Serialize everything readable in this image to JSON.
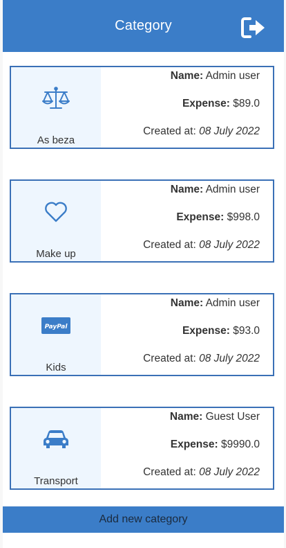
{
  "header": {
    "title": "Category",
    "logout_icon": "sign-out-icon"
  },
  "labels": {
    "name": "Name:",
    "expense": "Expense:",
    "created": "Created at:"
  },
  "categories": [
    {
      "name": "As beza",
      "icon": "balance-scale-icon",
      "user": "Admin user",
      "expense": "$89.0",
      "created": "08 July 2022"
    },
    {
      "name": "Make up",
      "icon": "heart-icon",
      "user": "Admin user",
      "expense": "$998.0",
      "created": "08 July 2022"
    },
    {
      "name": "Kids",
      "icon": "paypal-icon",
      "icon_text": "PayPal",
      "user": "Admin user",
      "expense": "$93.0",
      "created": "08 July 2022"
    },
    {
      "name": "Transport",
      "icon": "car-icon",
      "user": "Guest User",
      "expense": "$9990.0",
      "created": "08 July 2022"
    }
  ],
  "footer": {
    "add_label": "Add new category"
  },
  "colors": {
    "brand": "#3b7dc8",
    "card_border": "#3a70b6",
    "icon_panel": "#eef6fe"
  }
}
